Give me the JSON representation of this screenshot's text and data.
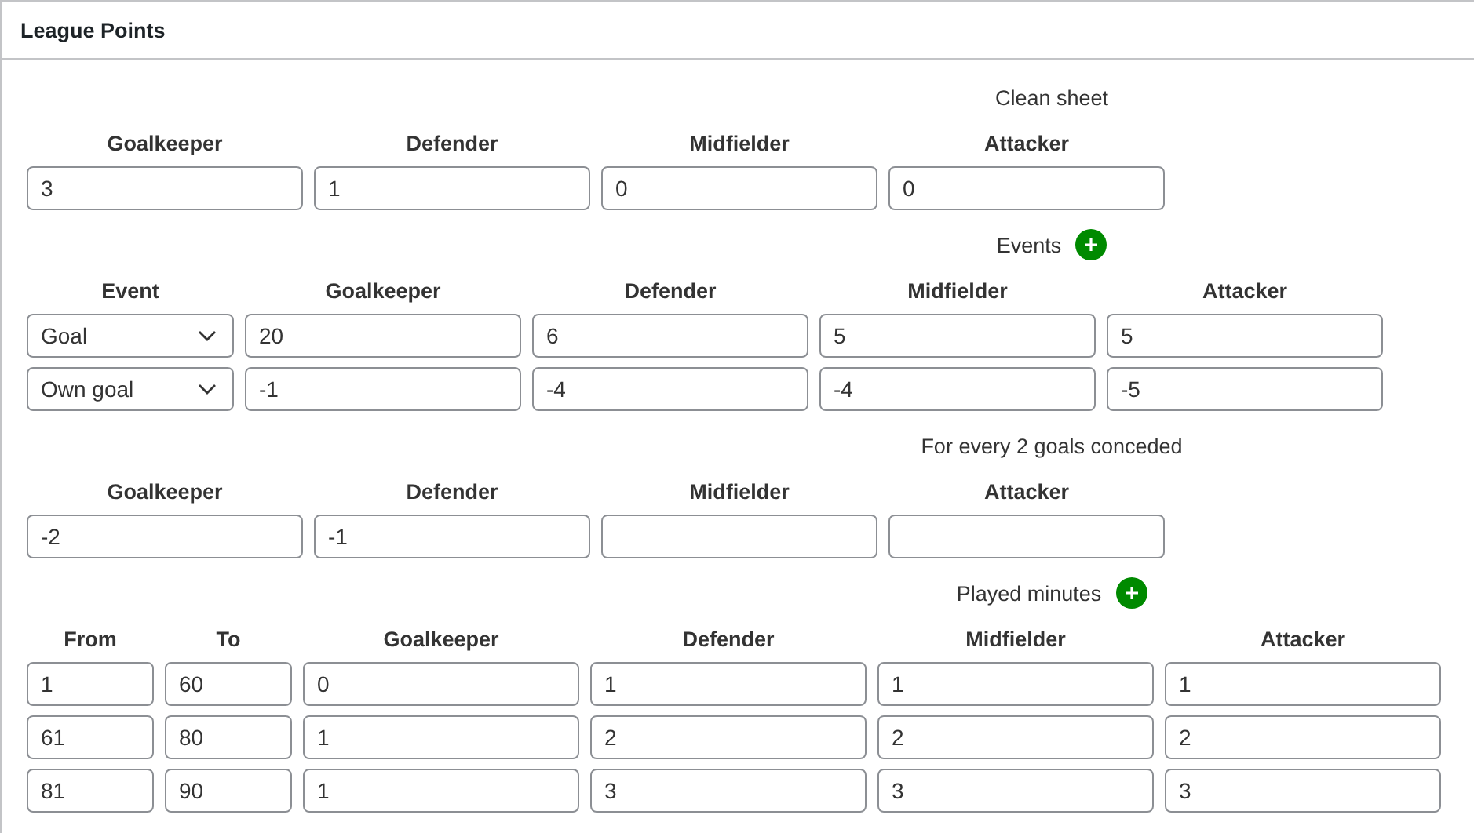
{
  "panel": {
    "title": "League Points"
  },
  "sections": [
    {
      "title": "Clean sheet",
      "add_button": false,
      "columns": [
        {
          "label": "Goalkeeper",
          "kind": "number"
        },
        {
          "label": "Defender",
          "kind": "number"
        },
        {
          "label": "Midfielder",
          "kind": "number"
        },
        {
          "label": "Attacker",
          "kind": "number"
        }
      ],
      "rows": [
        [
          "3",
          "1",
          "0",
          "0"
        ]
      ]
    },
    {
      "title": "Events",
      "add_button": true,
      "columns": [
        {
          "label": "Event",
          "kind": "select"
        },
        {
          "label": "Goalkeeper",
          "kind": "number"
        },
        {
          "label": "Defender",
          "kind": "number"
        },
        {
          "label": "Midfielder",
          "kind": "number"
        },
        {
          "label": "Attacker",
          "kind": "number"
        }
      ],
      "rows": [
        [
          "Goal",
          "20",
          "6",
          "5",
          "5"
        ],
        [
          "Own goal",
          "-1",
          "-4",
          "-4",
          "-5"
        ]
      ]
    },
    {
      "title": "For every 2 goals conceded",
      "add_button": false,
      "columns": [
        {
          "label": "Goalkeeper",
          "kind": "number"
        },
        {
          "label": "Defender",
          "kind": "number"
        },
        {
          "label": "Midfielder",
          "kind": "number"
        },
        {
          "label": "Attacker",
          "kind": "number"
        }
      ],
      "rows": [
        [
          "-2",
          "-1",
          null,
          null
        ]
      ]
    },
    {
      "title": "Played minutes",
      "add_button": true,
      "columns": [
        {
          "label": "From",
          "kind": "minute"
        },
        {
          "label": "To",
          "kind": "minute"
        },
        {
          "label": "Goalkeeper",
          "kind": "number"
        },
        {
          "label": "Defender",
          "kind": "number"
        },
        {
          "label": "Midfielder",
          "kind": "number"
        },
        {
          "label": "Attacker",
          "kind": "number"
        }
      ],
      "rows": [
        [
          "1",
          "60",
          "0",
          "1",
          "1",
          "1"
        ],
        [
          "61",
          "80",
          "1",
          "2",
          "2",
          "2"
        ],
        [
          "81",
          "90",
          "1",
          "3",
          "3",
          "3"
        ]
      ]
    }
  ]
}
